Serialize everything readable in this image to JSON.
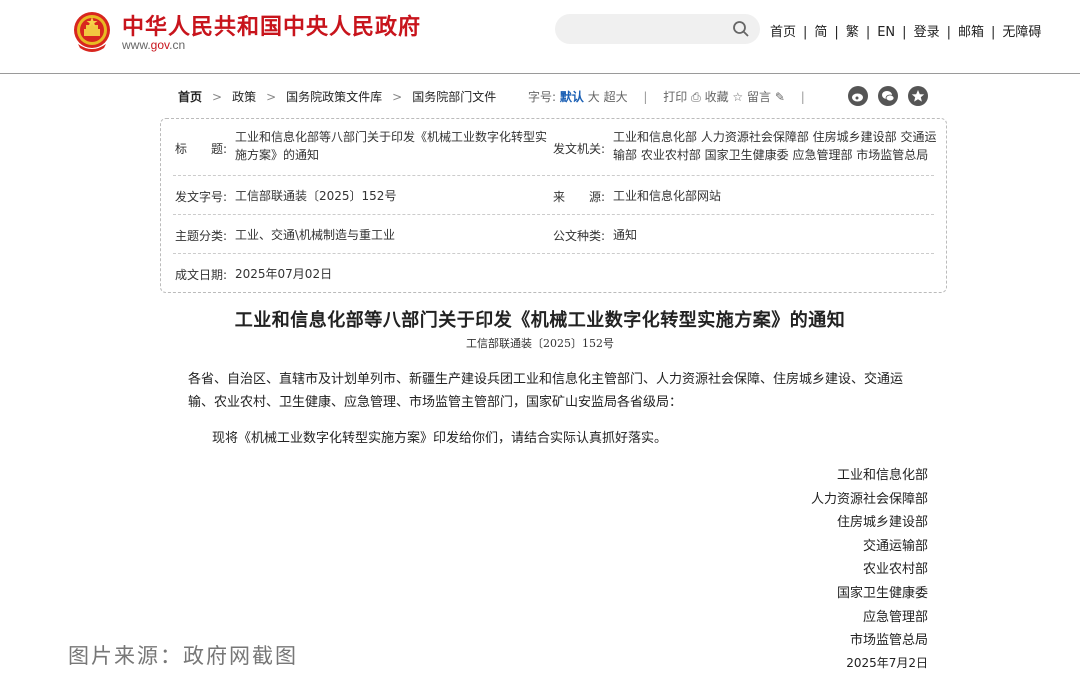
{
  "header": {
    "site_title": "中华人民共和国中央人民政府",
    "site_url_prefix": "www.",
    "site_url_brand": "gov",
    "site_url_suffix": ".cn",
    "search_placeholder": "",
    "nav": [
      "首页",
      "简",
      "繁",
      "EN",
      "登录",
      "邮箱",
      "无障碍"
    ]
  },
  "breadcrumb": [
    "首页",
    "政策",
    "国务院政策文件库",
    "国务院部门文件"
  ],
  "tools": {
    "font_label": "字号:",
    "font_default": "默认",
    "font_large": "大",
    "font_xlarge": "超大",
    "print": "打印",
    "favorite": "收藏",
    "comment": "留言"
  },
  "meta": {
    "title_label": "标　　题:",
    "title_value": "工业和信息化部等八部门关于印发《机械工业数字化转型实施方案》的通知",
    "issuer_label": "发文机关:",
    "issuer_value": "工业和信息化部 人力资源社会保障部 住房城乡建设部 交通运输部 农业农村部 国家卫生健康委 应急管理部 市场监管总局",
    "docno_label": "发文字号:",
    "docno_value": "工信部联通装〔2025〕152号",
    "source_label": "来　　源:",
    "source_value": "工业和信息化部网站",
    "topic_label": "主题分类:",
    "topic_value": "工业、交通\\机械制造与重工业",
    "type_label": "公文种类:",
    "type_value": "通知",
    "date_label": "成文日期:",
    "date_value": "2025年07月02日"
  },
  "article": {
    "title": "工业和信息化部等八部门关于印发《机械工业数字化转型实施方案》的通知",
    "doc_no": "工信部联通装〔2025〕152号",
    "recipients": "各省、自治区、直辖市及计划单列市、新疆生产建设兵团工业和信息化主管部门、人力资源社会保障、住房城乡建设、交通运输、农业农村、卫生健康、应急管理、市场监管主管部门，国家矿山安监局各省级局：",
    "body": "现将《机械工业数字化转型实施方案》印发给你们，请结合实际认真抓好落实。",
    "signatories": [
      "工业和信息化部",
      "人力资源社会保障部",
      "住房城乡建设部",
      "交通运输部",
      "农业农村部",
      "国家卫生健康委",
      "应急管理部",
      "市场监管总局"
    ],
    "date": "2025年7月2日"
  },
  "watermark": "图片来源：政府网截图",
  "colors": {
    "brand_red": "#c8141c",
    "link_blue": "#1a5fb4"
  }
}
